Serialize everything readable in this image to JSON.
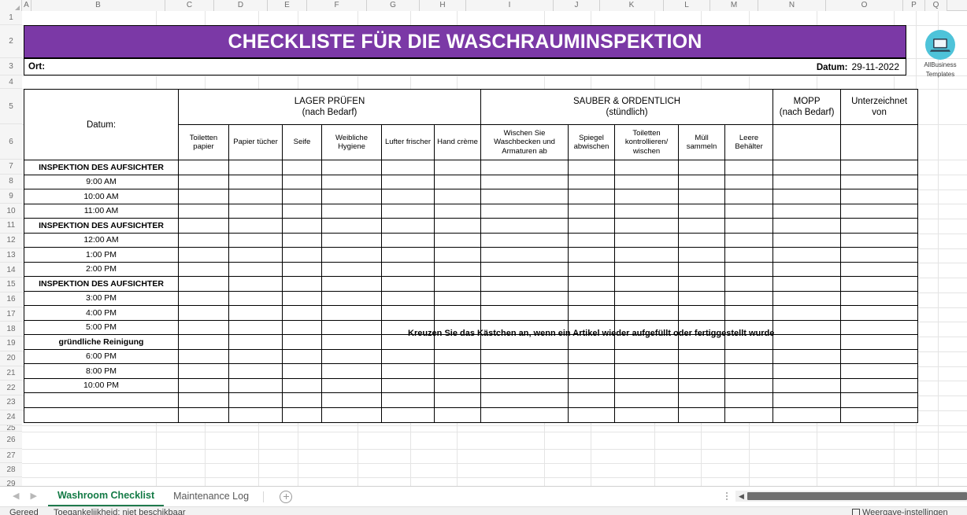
{
  "app": {
    "columns": [
      "A",
      "B",
      "C",
      "D",
      "E",
      "F",
      "G",
      "H",
      "I",
      "J",
      "K",
      "L",
      "M",
      "N",
      "O",
      "P",
      "Q"
    ],
    "row_numbers": [
      "1",
      "2",
      "3",
      "4",
      "5",
      "6",
      "7",
      "8",
      "9",
      "10",
      "11",
      "12",
      "13",
      "14",
      "15",
      "16",
      "17",
      "18",
      "19",
      "20",
      "21",
      "22",
      "23",
      "24",
      "25",
      "26",
      "27",
      "28",
      "29"
    ]
  },
  "banner": {
    "title": "CHECKLISTE FÜR DIE WASCHRAUMINSPEKTION",
    "background_color": "#7B39A6",
    "text_color": "#FFFFFF"
  },
  "info_row": {
    "ort_label": "Ort:",
    "ort_value": "",
    "datum_label": "Datum:",
    "datum_value": "29-11-2022"
  },
  "logo": {
    "icon": "laptop-icon",
    "line1": "AllBusiness",
    "line2": "Templates",
    "circle_color": "#4EC3D9"
  },
  "table": {
    "datum_header": "Datum:",
    "groups": [
      {
        "title": "LAGER PRÜFEN",
        "subtitle": "(nach Bedarf)",
        "span": 6
      },
      {
        "title": "SAUBER & ORDENTLICH",
        "subtitle": "(stündlich)",
        "span": 5
      },
      {
        "title": "MOPP",
        "subtitle": "(nach Bedarf)",
        "span": 1
      },
      {
        "title": "Unterzeichnet",
        "subtitle": "von",
        "span": 1
      }
    ],
    "subheaders": [
      "Toiletten papier",
      "Papier tücher",
      "Seife",
      "Weibliche Hygiene",
      "Lufter frischer",
      "Hand crème",
      "Wischen Sie Waschbecken und Armaturen ab",
      "Spiegel abwischen",
      "Toiletten kontrollieren/ wischen",
      "Müll sammeln",
      "Leere Behälter",
      "",
      ""
    ],
    "rows": [
      {
        "label": "INSPEKTION DES AUFSICHTER",
        "section": true
      },
      {
        "label": "9:00 AM",
        "section": false
      },
      {
        "label": "10:00 AM",
        "section": false
      },
      {
        "label": "11:00 AM",
        "section": false
      },
      {
        "label": "INSPEKTION DES AUFSICHTER",
        "section": true
      },
      {
        "label": "12:00 AM",
        "section": false
      },
      {
        "label": "1:00 PM",
        "section": false
      },
      {
        "label": "2:00 PM",
        "section": false
      },
      {
        "label": "INSPEKTION DES AUFSICHTER",
        "section": true
      },
      {
        "label": "3:00 PM",
        "section": false
      },
      {
        "label": "4:00 PM",
        "section": false
      },
      {
        "label": "5:00 PM",
        "section": false
      },
      {
        "label": "gründliche Reinigung",
        "section": true
      },
      {
        "label": "6:00 PM",
        "section": false
      },
      {
        "label": "8:00 PM",
        "section": false
      },
      {
        "label": "10:00 PM",
        "section": false
      },
      {
        "label": "",
        "section": false
      },
      {
        "label": "",
        "section": false
      }
    ]
  },
  "footnote": "Kreuzen Sie das Kästchen an, wenn ein Artikel wieder aufgefüllt oder fertiggestellt wurde",
  "tabbar": {
    "prev_arrow": "◀",
    "next_arrow": "▶",
    "tabs": [
      {
        "label": "Washroom Checklist",
        "active": true
      },
      {
        "label": "Maintenance Log",
        "active": false
      }
    ],
    "add_sheet_tooltip": "+"
  },
  "scrollbar": {
    "left_arrow": "◀"
  },
  "statusbar": {
    "ready": "Gereed",
    "accessibility": "Toegankelijkheid: niet beschikbaar",
    "view_settings": "Weergave-instellingen"
  }
}
